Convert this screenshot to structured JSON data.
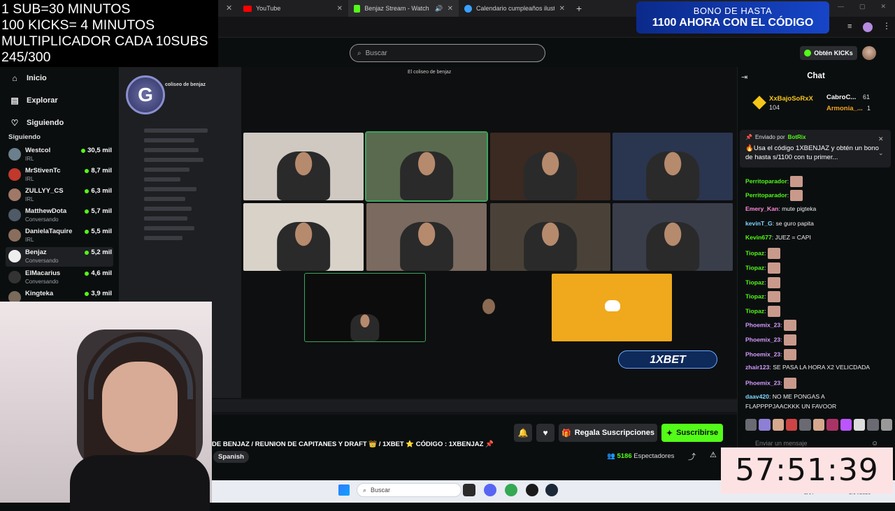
{
  "browser": {
    "tabs": [
      {
        "label": "YouTube",
        "active": false
      },
      {
        "label": "Benjaz Stream - Watch Live",
        "active": true
      },
      {
        "label": "Calendario cumpleaños ilustrac",
        "active": false
      }
    ],
    "new_tab": "+"
  },
  "overlay": {
    "lines": [
      "1 SUB=30 MINUTOS",
      "100 KICKS= 4 MINUTOS",
      "MULTIPLICADOR CADA 10SUBS",
      "245/300"
    ]
  },
  "promo": {
    "line1": "BONO DE HASTA",
    "line2": "1100 AHORA CON EL CÓDIGO"
  },
  "header": {
    "search_placeholder": "Buscar",
    "kicks_button": "Obtén KICKs"
  },
  "sidebar": {
    "nav": [
      {
        "label": "Inicio",
        "icon": "home-icon"
      },
      {
        "label": "Explorar",
        "icon": "compass-icon"
      },
      {
        "label": "Siguiendo",
        "icon": "heart-icon"
      }
    ],
    "following_title": "Siguiendo",
    "following": [
      {
        "name": "Westcol",
        "category": "IRL",
        "viewers": "30,5 mil"
      },
      {
        "name": "MrStivenTc",
        "category": "IRL",
        "viewers": "8,7 mil"
      },
      {
        "name": "ZULLYY_CS",
        "category": "IRL",
        "viewers": "6,3 mil"
      },
      {
        "name": "MatthewDota",
        "category": "Conversando",
        "viewers": "5,7 mil"
      },
      {
        "name": "DanielaTaquire",
        "category": "IRL",
        "viewers": "5,5 mil"
      },
      {
        "name": "Benjaz",
        "category": "Conversando",
        "viewers": "5,2 mil"
      },
      {
        "name": "ElMacarius",
        "category": "Conversando",
        "viewers": "4,6 mil"
      },
      {
        "name": "Kingteka",
        "category": "",
        "viewers": "3,9 mil"
      }
    ]
  },
  "stream": {
    "window_title": "El coliseo de benjaz",
    "server_name": "coliseo de benjaz",
    "brand_banner": "1XBET",
    "title": "DE BENJAZ / REUNION DE CAPITANES Y DRAFT 👑 / 1XBET ⭐ CÓDIGO : 1XBENJAZ 📌",
    "language": "Spanish",
    "viewers_count": "5186",
    "viewers_label": "Espectadores",
    "gift_button": "Regala Suscripciones",
    "subscribe_button": "Suscribirse"
  },
  "chat": {
    "title": "Chat",
    "leaders": [
      {
        "name": "XxBajoSoRxX",
        "value": "104"
      },
      {
        "name": "CabroC...",
        "value": "61"
      },
      {
        "name": "Armonia_...",
        "value": "1"
      }
    ],
    "pinned": {
      "prefix": "Enviado por",
      "author": "BotRix",
      "message": "🔥Usa el código 1XBENJAZ y obtén un bono de hasta s/1100 con tu primer..."
    },
    "messages": [
      {
        "user": "Perritoparador",
        "text": "",
        "color": "#53fc18"
      },
      {
        "user": "Perritoparador",
        "text": "",
        "color": "#53fc18"
      },
      {
        "user": "Emery_Kan",
        "text": "mute pigteka",
        "color": "#ff8ad8"
      },
      {
        "user": "kevinT_G",
        "text": "se guro papita",
        "color": "#7fd7ff"
      },
      {
        "user": "Kevin677",
        "text": "JUEZ = CAPI",
        "color": "#53fc18"
      },
      {
        "user": "Tiopaz",
        "text": "",
        "color": "#53fc18"
      },
      {
        "user": "Tiopaz",
        "text": "",
        "color": "#53fc18"
      },
      {
        "user": "Tiopaz",
        "text": "",
        "color": "#53fc18"
      },
      {
        "user": "Tiopaz",
        "text": "",
        "color": "#53fc18"
      },
      {
        "user": "Tiopaz",
        "text": "",
        "color": "#53fc18"
      },
      {
        "user": "Phoemix_23",
        "text": "",
        "color": "#d59bff"
      },
      {
        "user": "Phoemix_23",
        "text": "",
        "color": "#d59bff"
      },
      {
        "user": "Phoemix_23",
        "text": "",
        "color": "#d59bff"
      },
      {
        "user": "zhair123",
        "text": "SE PASA LA HORA X2 VELICDADA",
        "color": "#d59bff"
      },
      {
        "user": "Phoemix_23",
        "text": "",
        "color": "#d59bff"
      },
      {
        "user": "daav420",
        "text": "NO ME PONGAS A",
        "color": "#7fd7ff"
      }
    ],
    "last_line": "FLAPPPPJAACKKK UN FAVOOR",
    "input_placeholder": "Enviar un mensaje"
  },
  "timer": "57:51:39",
  "taskbar": {
    "search": "Buscar",
    "lang": "LAA",
    "date": "9/04/2026"
  },
  "colors": {
    "accent": "#53fc18",
    "bg": "#0b0e0f",
    "discord_orange": "#f0a91c"
  }
}
